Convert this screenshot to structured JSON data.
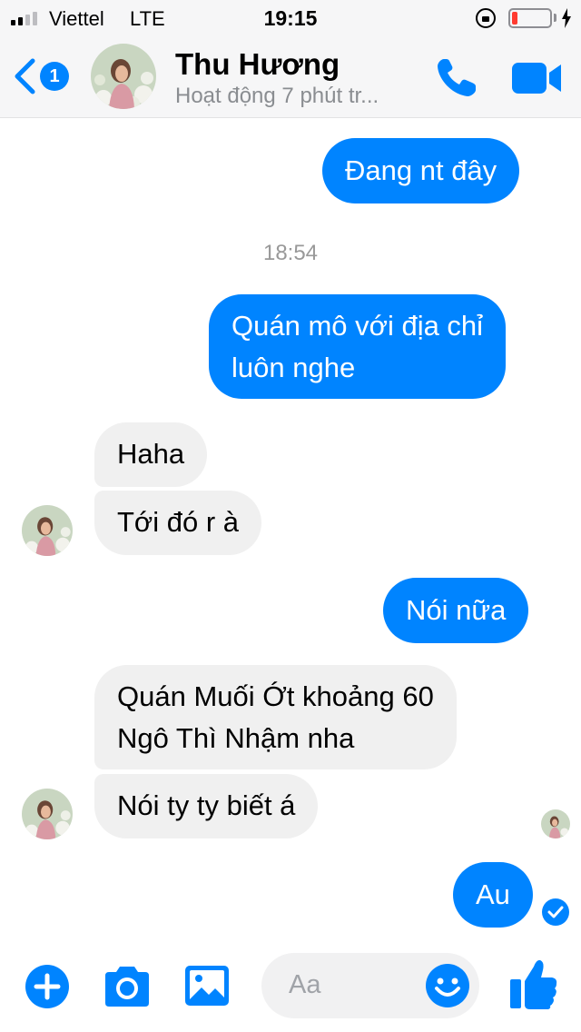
{
  "status_bar": {
    "carrier": "Viettel",
    "network": "LTE",
    "time": "19:15",
    "battery_level": 0.15,
    "signal_bars_filled": 2,
    "signal_bars_total": 4
  },
  "header": {
    "back_badge_count": "1",
    "contact_name": "Thu Hương",
    "contact_status": "Hoạt động 7 phút tr...",
    "icons": [
      "back-chevron-icon",
      "phone-icon",
      "video-camera-icon"
    ]
  },
  "messages": [
    {
      "direction": "outgoing",
      "text": "Đang nt đây"
    },
    {
      "type": "timestamp",
      "text": "18:54"
    },
    {
      "direction": "outgoing",
      "lines": [
        "Quán mô với địa chỉ",
        "luôn nghe"
      ]
    },
    {
      "direction": "incoming",
      "text": "Haha"
    },
    {
      "direction": "incoming",
      "text": "Tới đó r à"
    },
    {
      "direction": "outgoing",
      "text": "Nói nữa"
    },
    {
      "direction": "incoming",
      "lines": [
        "Quán Muối Ớt khoảng 60",
        "Ngô Thì Nhậm nha"
      ]
    },
    {
      "direction": "incoming",
      "text": "Nói ty ty biết á"
    },
    {
      "direction": "outgoing",
      "text": "Au"
    }
  ],
  "composer": {
    "placeholder": "Aa",
    "icons": [
      "plus-icon",
      "camera-icon",
      "image-icon",
      "emoji-icon",
      "thumbs-up-icon"
    ]
  },
  "colors": {
    "accent": "#0084ff",
    "incoming_bubble": "#f0f0f0",
    "header_bg": "#f6f6f7",
    "battery_low": "#ff3b30"
  }
}
